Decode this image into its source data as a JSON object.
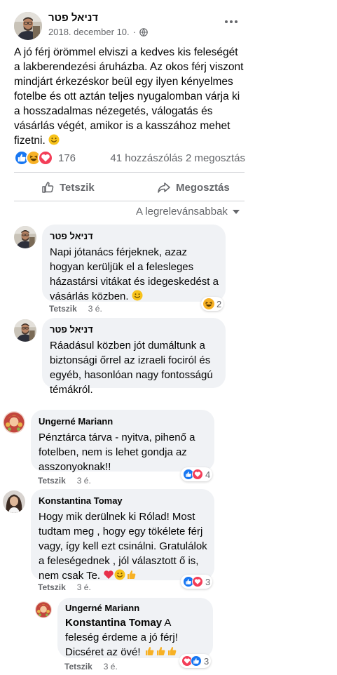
{
  "post": {
    "author": "דניאל פטר",
    "date": "2018. december 10.",
    "dot": "·",
    "text": "A jó férj örömmel elviszi a kedves kis feleségét a lakberendezési áruházba. Az okos férj viszont mindjárt érkezéskor beül egy ilyen kényelmes fotelbe és ott aztán teljes nyugalomban várja ki a hosszadalmas nézegetés, válogatás és vásárlás végét, amikor is a kasszához mehet fizetni.",
    "reaction_count": "176",
    "comments_shares": "41 hozzászólás  2 megosztás",
    "like_label": "Tetszik",
    "share_label": "Megosztás",
    "sort_label": "A legrelevánsabbak"
  },
  "comments": [
    {
      "author": "דניאל פטר",
      "text": "Napi jótanács férjeknek, azaz hogyan kerüljük el a felesleges házastársi vitákat és idegeskedést a vásárlás közben.",
      "like": "Tetszik",
      "time": "3 é.",
      "reaction_count": "2"
    },
    {
      "author": "דניאל פטר",
      "text": "Ráadásul közben jót dumáltunk a biztonsági őrrel az izraeli fociról és egyéb, hasonlóan nagy fontosságú témákról."
    },
    {
      "author": "Ungerné Mariann",
      "text": "Pénztárca tárva - nyitva, pihenő a fotelben, nem is lehet gondja az asszonyoknak!!",
      "like": "Tetszik",
      "time": "3 é.",
      "reaction_count": "4"
    },
    {
      "author": "Konstantina Tomay",
      "text": "Hogy mik derülnek ki Rólad! Most tudtam meg , hogy egy tökélete férj vagy, így kell ezt csinálni. Gratulálok a feleségednek , jól választott ő is, nem csak Te.",
      "like": "Tetszik",
      "time": "3 é.",
      "reaction_count": "3"
    },
    {
      "author": "Ungerné Mariann",
      "mention": "Konstantina Tomay",
      "text": " A feleség érdeme a jó férj! Dicséret az övé!",
      "like": "Tetszik",
      "time": "3 é.",
      "reaction_count": "3"
    }
  ],
  "colors": {
    "like_blue": "#1877f2",
    "haha_yellow": "#f7b125",
    "love_red": "#f33e58",
    "secondary_text": "#65676b",
    "bubble_bg": "#f0f2f5"
  },
  "icons": [
    "globe-icon",
    "more-icon",
    "like-reaction-icon",
    "haha-reaction-icon",
    "love-reaction-icon",
    "thumbs-up-icon",
    "share-arrow-icon",
    "caret-down-icon",
    "smile-emoji",
    "heart-emoji",
    "thumbs-up-emoji"
  ]
}
